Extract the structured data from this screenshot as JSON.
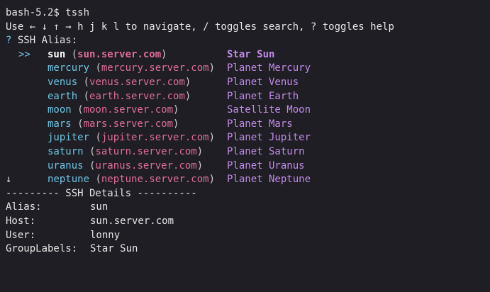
{
  "prompt_line": "bash-5.2$ tssh",
  "help_line": "Use ← ↓ ↑ → h j k l to navigate, / toggles search, ? toggles help",
  "alias_prompt": {
    "marker": "?",
    "label": "SSH Alias:"
  },
  "selected_marker": ">>",
  "scroll_marker": "↓",
  "hosts": [
    {
      "name": "sun",
      "host": "sun.server.com",
      "group": "Star Sun",
      "selected": true
    },
    {
      "name": "mercury",
      "host": "mercury.server.com",
      "group": "Planet Mercury",
      "selected": false
    },
    {
      "name": "venus",
      "host": "venus.server.com",
      "group": "Planet Venus",
      "selected": false
    },
    {
      "name": "earth",
      "host": "earth.server.com",
      "group": "Planet Earth",
      "selected": false
    },
    {
      "name": "moon",
      "host": "moon.server.com",
      "group": "Satellite Moon",
      "selected": false
    },
    {
      "name": "mars",
      "host": "mars.server.com",
      "group": "Planet Mars",
      "selected": false
    },
    {
      "name": "jupiter",
      "host": "jupiter.server.com",
      "group": "Planet Jupiter",
      "selected": false
    },
    {
      "name": "saturn",
      "host": "saturn.server.com",
      "group": "Planet Saturn",
      "selected": false
    },
    {
      "name": "uranus",
      "host": "uranus.server.com",
      "group": "Planet Uranus",
      "selected": false
    },
    {
      "name": "neptune",
      "host": "neptune.server.com",
      "group": "Planet Neptune",
      "selected": false
    }
  ],
  "details_header": "--------- SSH Details ----------",
  "details": [
    {
      "key": "Alias:",
      "value": "sun"
    },
    {
      "key": "Host:",
      "value": "sun.server.com"
    },
    {
      "key": "User:",
      "value": "lonny"
    },
    {
      "key": "GroupLabels:",
      "value": "Star Sun"
    }
  ],
  "colors": {
    "background": "#1e1e24",
    "alias_name": "#6ec6e6",
    "hostname": "#e06c9a",
    "group_label": "#c18be8",
    "text": "#e6e6e6"
  }
}
